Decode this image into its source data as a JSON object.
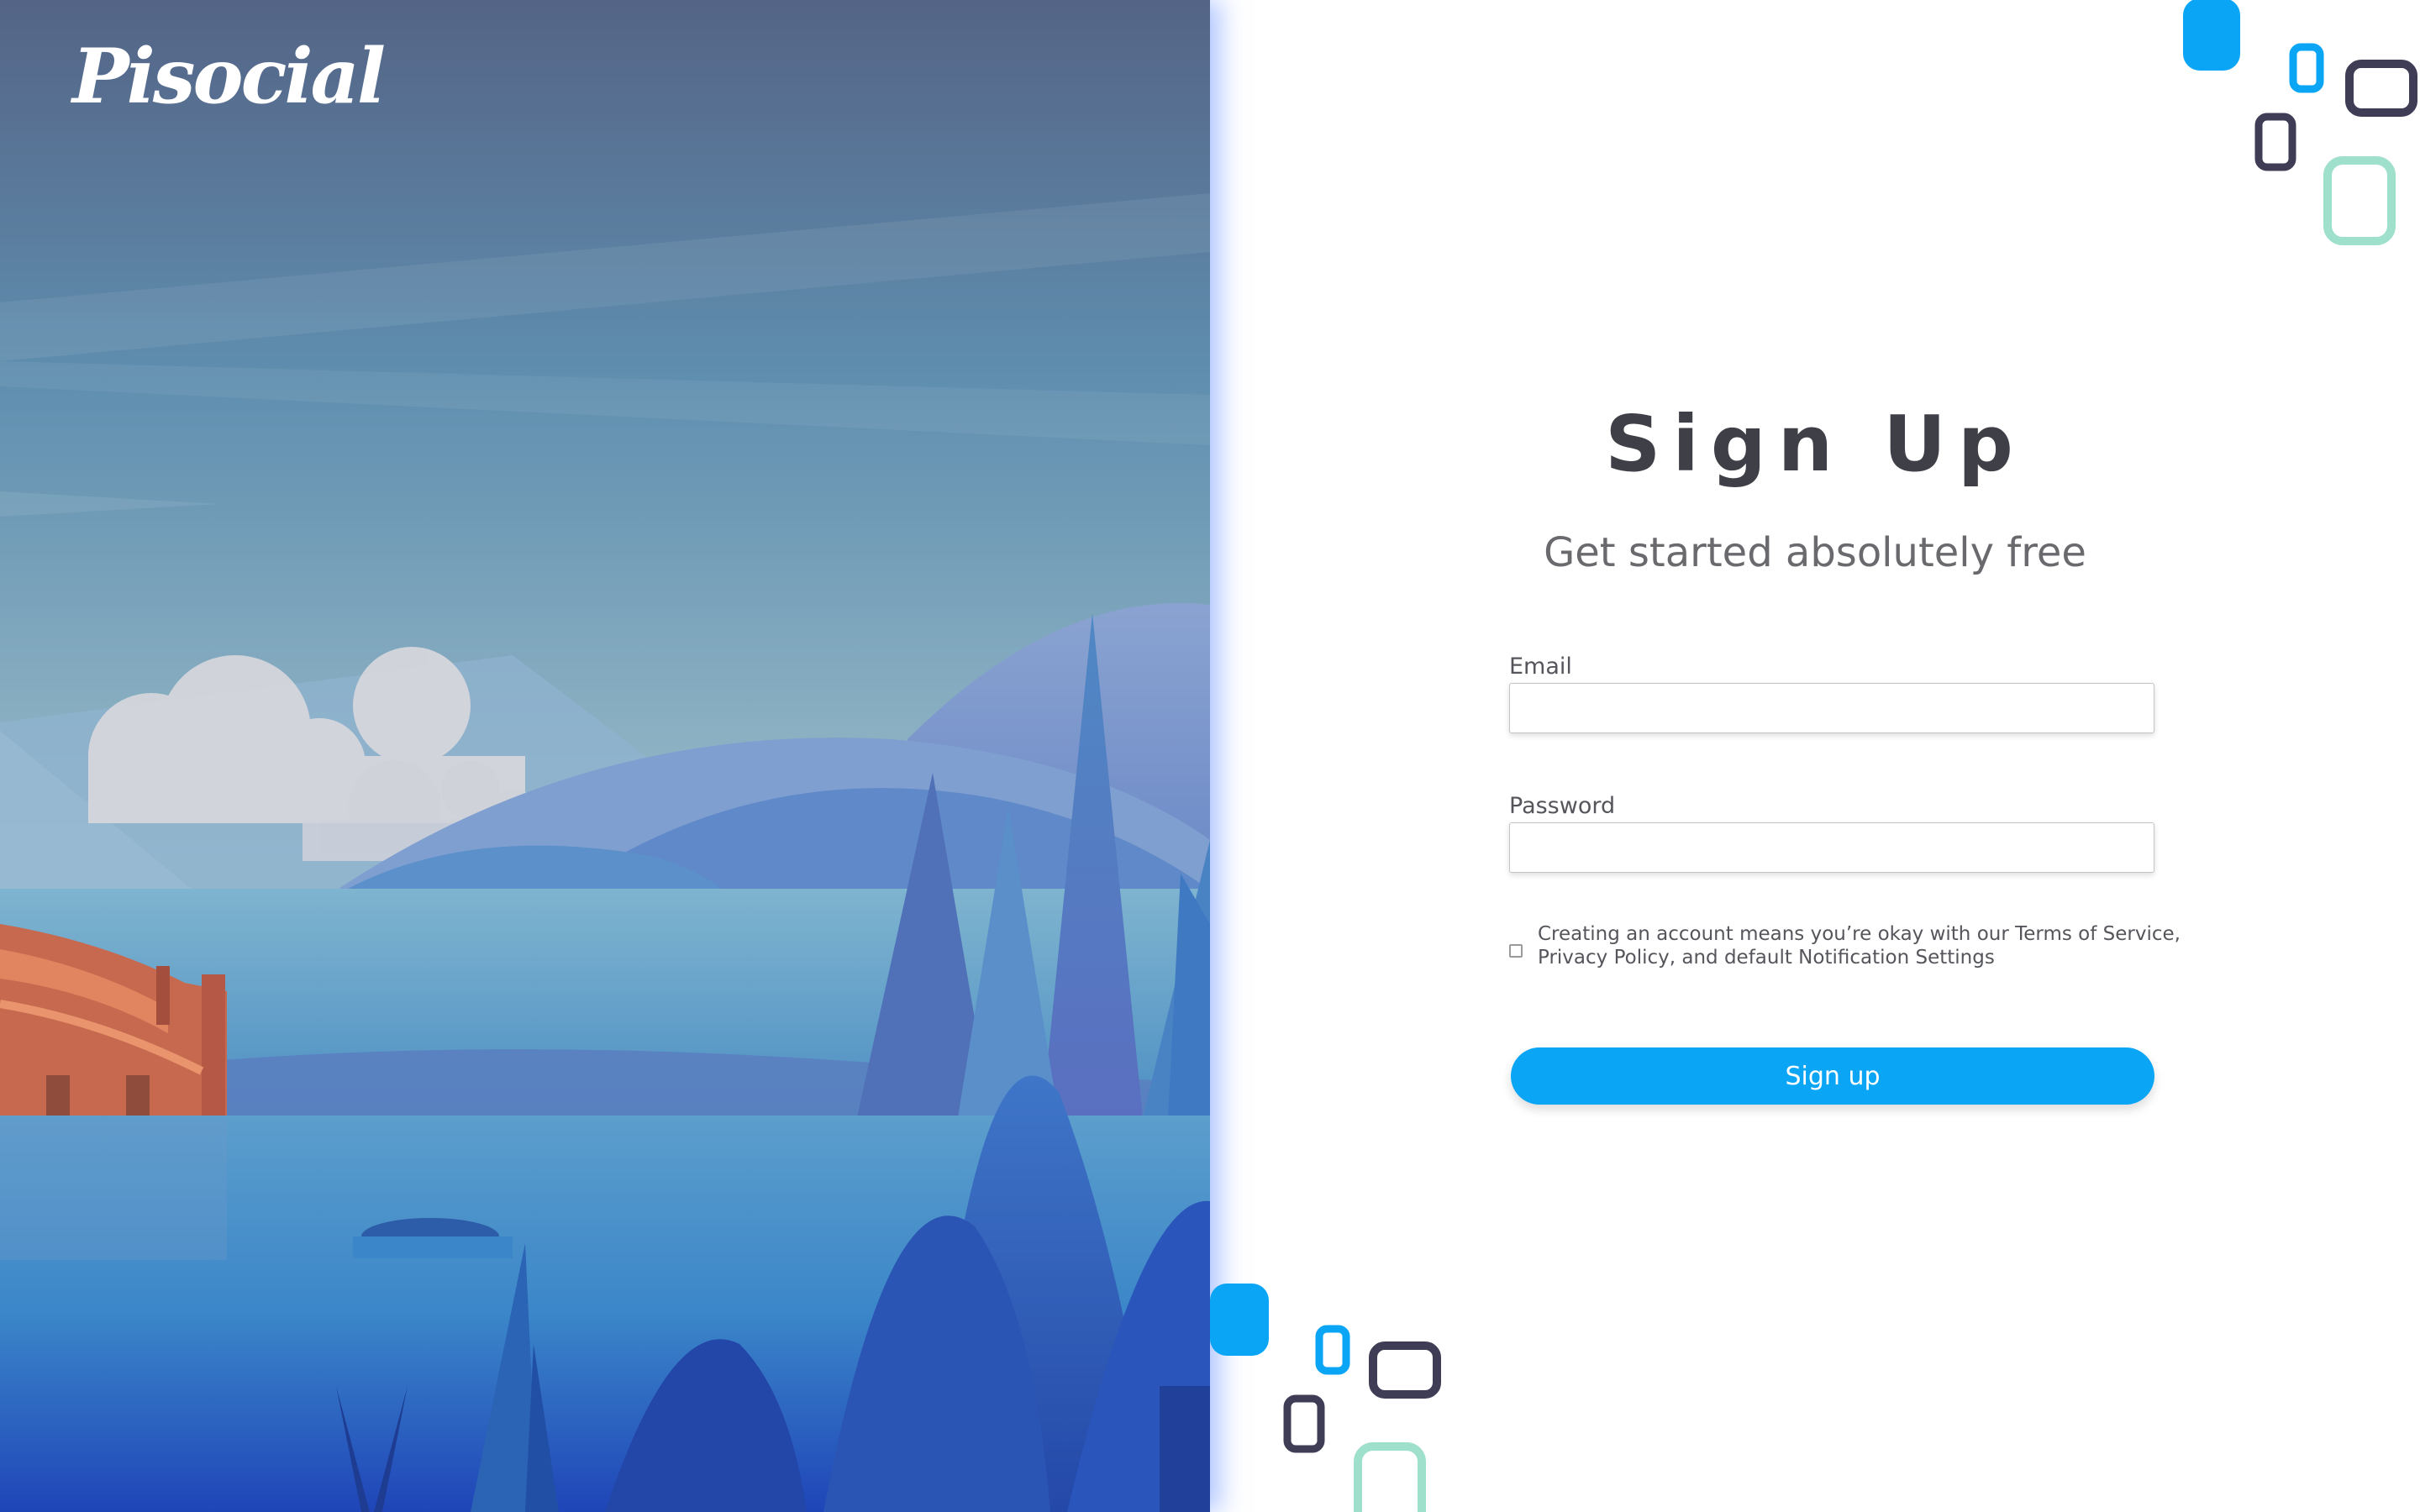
{
  "brand": {
    "logo_text": "Pisocial"
  },
  "signup": {
    "title": "Sign Up",
    "subtitle": "Get started absolutely free",
    "email_label": "Email",
    "email_value": "",
    "password_label": "Password",
    "password_value": "",
    "terms_text": "Creating an account means you’re okay with our Terms of Service, Privacy Policy, and default Notification Settings",
    "terms_checked": false,
    "submit_label": "Sign up"
  },
  "colors": {
    "accent": "#0aa6f5",
    "heading": "#3e3f47",
    "deco_blue": "#0aa6f5",
    "deco_navy": "#3f3d56",
    "deco_mint": "#9fe0cc"
  },
  "icons": [
    "decorative-squares-icon"
  ]
}
